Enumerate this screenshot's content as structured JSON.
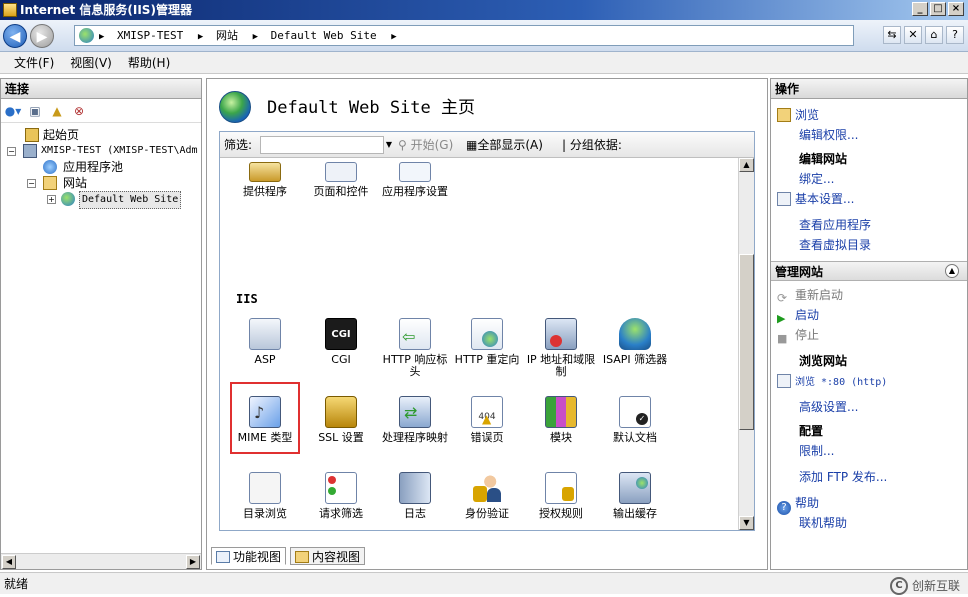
{
  "window": {
    "title": "Internet 信息服务(IIS)管理器"
  },
  "address": {
    "crumbs": [
      "XMISP-TEST",
      "网站",
      "Default Web Site"
    ]
  },
  "menu": {
    "items": [
      "文件(F)",
      "视图(V)",
      "帮助(H)"
    ]
  },
  "connections": {
    "title": "连接",
    "tree": [
      {
        "label": "起始页"
      },
      {
        "label": "XMISP-TEST (XMISP-TEST\\Adm"
      },
      {
        "label": "应用程序池"
      },
      {
        "label": "网站"
      },
      {
        "label": "Default Web Site"
      }
    ]
  },
  "center": {
    "title": "Default Web Site 主页",
    "filter": {
      "label": "筛选:",
      "start": "开始(G)",
      "show_all": "全部显示(A)",
      "group_by": "分组依据:"
    },
    "top_row": [
      "提供程序",
      "页面和控件",
      "应用程序设置"
    ],
    "section_iis": "IIS",
    "features": [
      {
        "label": "ASP",
        "icon": "asp-icon"
      },
      {
        "label": "CGI",
        "icon": "cgi-icon"
      },
      {
        "label": "HTTP 响应标头",
        "icon": "http-response-headers-icon"
      },
      {
        "label": "HTTP 重定向",
        "icon": "http-redirect-icon"
      },
      {
        "label": "IP 地址和域限制",
        "icon": "ip-restrictions-icon"
      },
      {
        "label": "ISAPI 筛选器",
        "icon": "isapi-filters-icon"
      },
      {
        "label": "MIME 类型",
        "icon": "mime-types-icon"
      },
      {
        "label": "SSL 设置",
        "icon": "ssl-lock-icon"
      },
      {
        "label": "处理程序映射",
        "icon": "handler-mappings-icon"
      },
      {
        "label": "错误页",
        "icon": "error-pages-icon"
      },
      {
        "label": "模块",
        "icon": "modules-icon"
      },
      {
        "label": "默认文档",
        "icon": "default-document-icon"
      },
      {
        "label": "目录浏览",
        "icon": "directory-browsing-icon"
      },
      {
        "label": "请求筛选",
        "icon": "request-filtering-icon"
      },
      {
        "label": "日志",
        "icon": "logging-icon"
      },
      {
        "label": "身份验证",
        "icon": "authentication-icon"
      },
      {
        "label": "授权规则",
        "icon": "authorization-rules-icon"
      },
      {
        "label": "输出缓存",
        "icon": "output-caching-icon"
      }
    ],
    "cgi_text": "CGI",
    "error_text": "404",
    "tabs": [
      "功能视图",
      "内容视图"
    ]
  },
  "actions": {
    "title": "操作",
    "browse": "浏览",
    "edit_permissions": "编辑权限...",
    "edit_site": "编辑网站",
    "bindings": "绑定...",
    "basic_settings": "基本设置...",
    "view_apps": "查看应用程序",
    "view_vdirs": "查看虚拟目录",
    "manage_site": "管理网站",
    "restart": "重新启动",
    "start": "启动",
    "stop": "停止",
    "browse_site": "浏览网站",
    "browse_http": "浏览 *:80 (http)",
    "advanced_settings": "高级设置...",
    "configure": "配置",
    "limits": "限制...",
    "add_ftp": "添加 FTP 发布...",
    "help_head": "帮助",
    "online_help": "联机帮助"
  },
  "status": {
    "text": "就绪",
    "watermark": "创新互联"
  },
  "colors": {
    "titlebar": "#0a246a",
    "link": "#1a3fa8",
    "highlight": "#e03030"
  }
}
